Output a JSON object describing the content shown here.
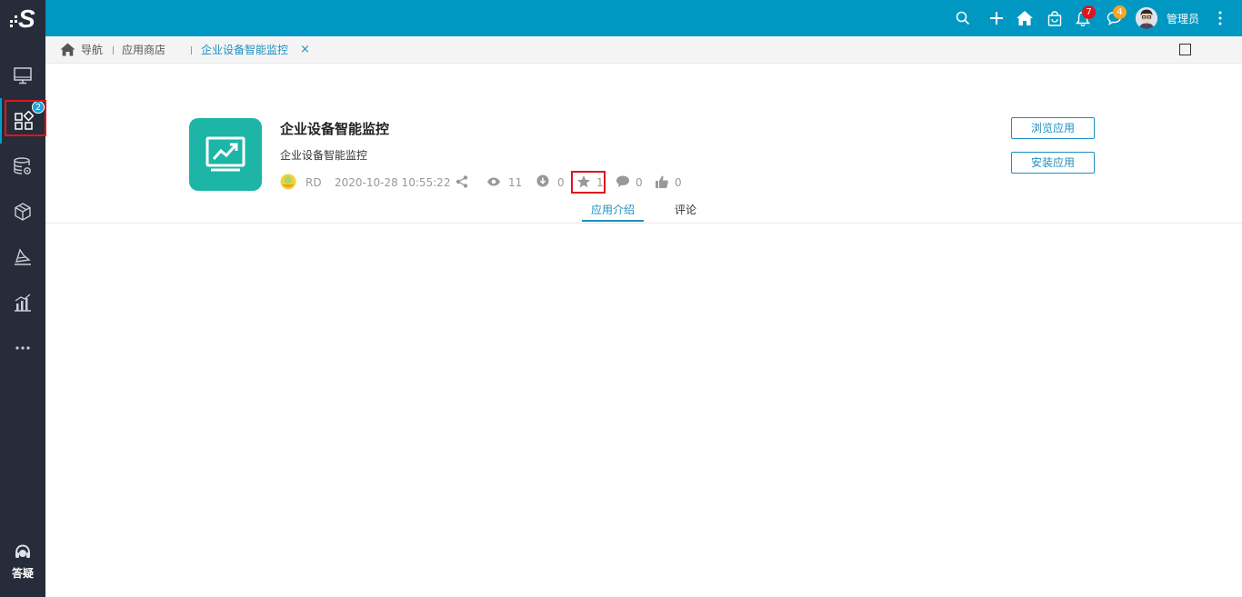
{
  "sidebar": {
    "items": [
      {
        "name": "monitor-icon"
      },
      {
        "name": "apps-icon",
        "badge": "2"
      },
      {
        "name": "database-gear-icon"
      },
      {
        "name": "cube-icon"
      },
      {
        "name": "layers-icon"
      },
      {
        "name": "bar-chart-icon"
      },
      {
        "name": "more-icon"
      }
    ],
    "help_label": "答疑"
  },
  "header": {
    "bell_badge": "7",
    "message_badge": "4",
    "username": "管理员",
    "colors": {
      "bar": "#0098c2",
      "bell_badge": "#e0141e",
      "message_badge": "#f5a623"
    }
  },
  "breadcrumb": {
    "home": "导航",
    "store": "应用商店",
    "current": "企业设备智能监控",
    "close_glyph": "×"
  },
  "app": {
    "title": "企业设备智能监控",
    "description": "企业设备智能监控",
    "author": "RD",
    "datetime": "2020-10-28 10:55:22",
    "views": "11",
    "downloads": "0",
    "favorites": "1",
    "comments": "0",
    "likes": "0",
    "icon_color": "#1cb5a6"
  },
  "actions": {
    "browse": "浏览应用",
    "install": "安装应用"
  },
  "tabs": {
    "intro": "应用介绍",
    "comments": "评论"
  }
}
